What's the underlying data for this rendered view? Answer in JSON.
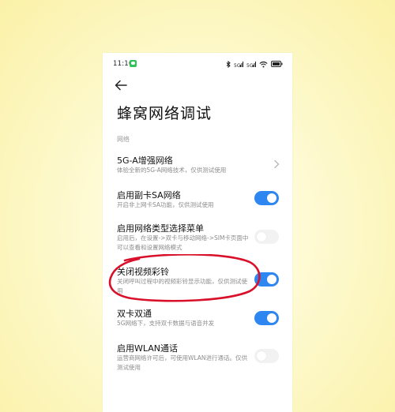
{
  "status_bar": {
    "time": "11:16",
    "icons": [
      "bluetooth-icon",
      "signal-sim1-icon",
      "signal-sim2-icon",
      "wifi-icon",
      "battery-icon"
    ]
  },
  "header": {
    "back_icon": "arrow-left-icon",
    "title": "蜂窝网络调试"
  },
  "section": {
    "label": "网络"
  },
  "settings": [
    {
      "title": "5G-A增强网络",
      "description": "体验全新的5G-A网络技术，仅供测试使用",
      "control": "chevron",
      "state": null
    },
    {
      "title": "启用副卡SA网络",
      "description": "开启非上网卡SA功能，仅供测试使用",
      "control": "toggle",
      "state": true
    },
    {
      "title": "启用网络类型选择菜单",
      "description": "启用后，在设置->双卡与移动网络->SIM卡页面中可以查看和设置网络模式",
      "control": "toggle",
      "state": false
    },
    {
      "title": "关闭视频彩铃",
      "description": "关闭呼叫过程中的视频彩铃显示功能，仅供测试使用",
      "control": "toggle",
      "state": true
    },
    {
      "title": "双卡双通",
      "description": "5G网络下，支持双卡数据与语音并发",
      "control": "toggle",
      "state": true
    },
    {
      "title": "启用WLAN通话",
      "description": "运营商网络许可后，可使用WLAN进行通话。仅供测试使用",
      "control": "toggle",
      "state": false
    }
  ],
  "colors": {
    "toggle_on": "#2e86f0",
    "toggle_off": "#f2f2f2",
    "annotation": "#d9102a",
    "background": "#fdf8c8"
  }
}
